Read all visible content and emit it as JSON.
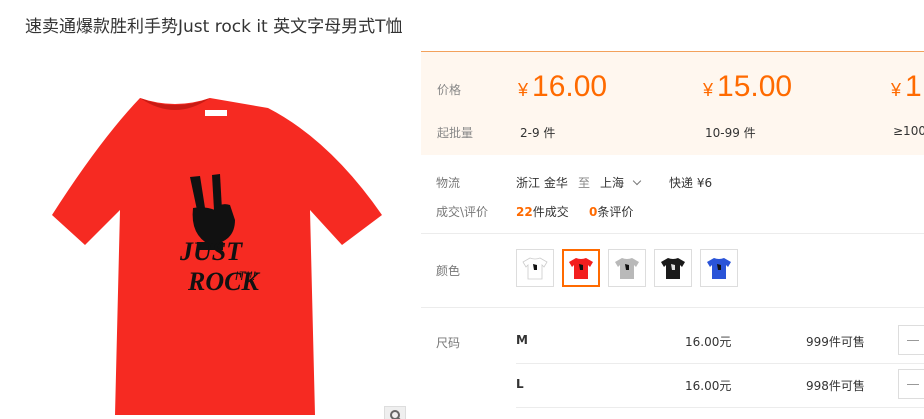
{
  "product": {
    "title": "速卖通爆款胜利手势Just rock it 英文字母男式T恤"
  },
  "price_panel": {
    "price_label": "价格",
    "moq_label": "起批量",
    "currency": "¥",
    "tiers": [
      {
        "price": "16.00",
        "qty": "2-9 件"
      },
      {
        "price": "15.00",
        "qty": "10-99 件"
      },
      {
        "price": "1",
        "qty": "≥100"
      }
    ]
  },
  "logistics": {
    "label": "物流",
    "origin": "浙江 金华",
    "to": "至",
    "destination": "上海",
    "shipping": "快递 ¥6"
  },
  "deals": {
    "label": "成交\\评价",
    "sold_count": "22",
    "sold_suffix": "件成交",
    "review_count": "0",
    "review_suffix": "条评价"
  },
  "color": {
    "label": "颜色",
    "options": [
      {
        "name": "white",
        "hex": "#ffffff"
      },
      {
        "name": "red",
        "hex": "#f31f1f"
      },
      {
        "name": "gray",
        "hex": "#b9b9b9"
      },
      {
        "name": "black",
        "hex": "#1a1a1a"
      },
      {
        "name": "blue",
        "hex": "#2a54d8"
      }
    ],
    "selected_index": 1
  },
  "sizes": {
    "label": "尺码",
    "rows": [
      {
        "size": "M",
        "price": "16.00元",
        "stock": "999件可售"
      },
      {
        "size": "L",
        "price": "16.00元",
        "stock": "998件可售"
      }
    ]
  },
  "shirt": {
    "color": "#f62a22",
    "print_line1": "JUST",
    "print_line2": "ROCK",
    "print_line3": "IT!!!"
  },
  "colors": {
    "accent": "#ff6a00",
    "panel_bg": "#fff7ef"
  }
}
